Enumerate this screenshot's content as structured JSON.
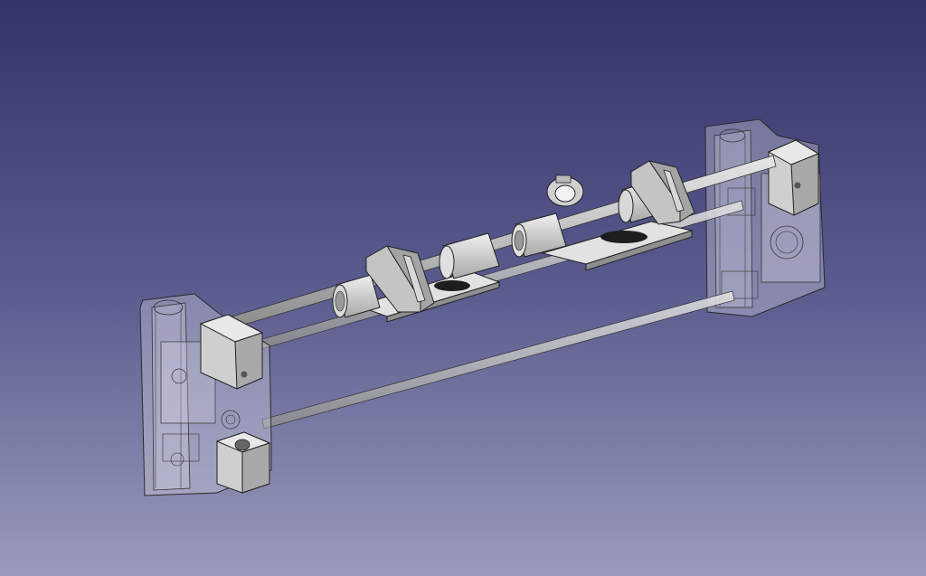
{
  "viewport": {
    "background_top": "#34336a",
    "background_bottom": "#9a9bbc"
  },
  "model": {
    "part_color": "#c9c9c9",
    "transparent_color": "#d8d8e4",
    "edge_color": "#2a2a2a"
  }
}
